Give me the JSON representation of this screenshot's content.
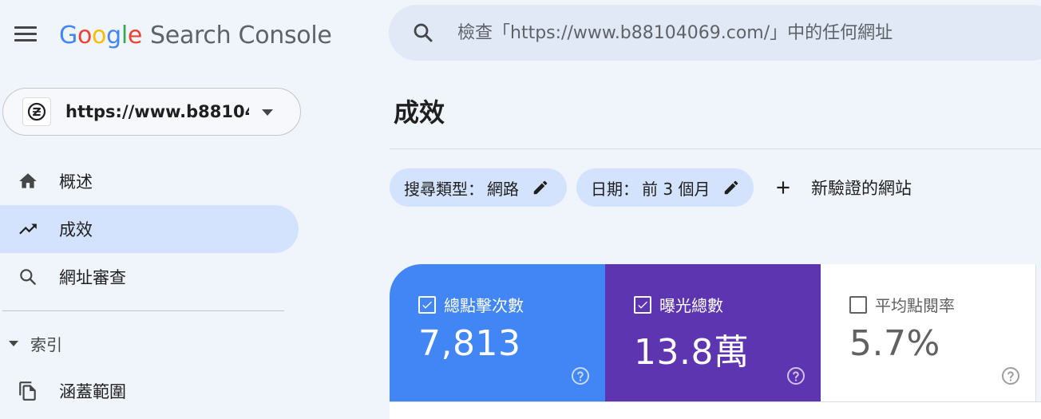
{
  "header": {
    "logo_letters": [
      "G",
      "o",
      "o",
      "g",
      "l",
      "e"
    ],
    "product_name": "Search Console",
    "search_placeholder": "檢查「https://www.b88104069.com/」中的任何網址"
  },
  "sidebar": {
    "property_url": "https://www.b88104...",
    "property_icon_glyph": "Ⓩ",
    "items": [
      {
        "label": "概述",
        "icon": "home-icon"
      },
      {
        "label": "成效",
        "icon": "trending-up-icon",
        "active": true
      },
      {
        "label": "網址審查",
        "icon": "search-icon"
      }
    ],
    "section_label": "索引",
    "section_items": [
      {
        "label": "涵蓋範圍",
        "icon": "copy-icon"
      }
    ]
  },
  "main": {
    "page_title": "成效",
    "filters": [
      {
        "label": "搜尋類型：",
        "value": "網路"
      },
      {
        "label": "日期：",
        "value": "前 3 個月"
      }
    ],
    "add_label": "新驗證的網站",
    "metrics": [
      {
        "label": "總點擊次數",
        "value": "7,813",
        "checked": true,
        "color": "#4285f4"
      },
      {
        "label": "曝光總數",
        "value": "13.8萬",
        "checked": true,
        "color": "#5e35b1"
      },
      {
        "label": "平均點閱率",
        "value": "5.7%",
        "checked": false,
        "color": "#ffffff"
      }
    ]
  },
  "colors": {
    "accent": "#1a73e8",
    "active_nav": "#d3e3fd",
    "background": "#f0f4fb"
  }
}
